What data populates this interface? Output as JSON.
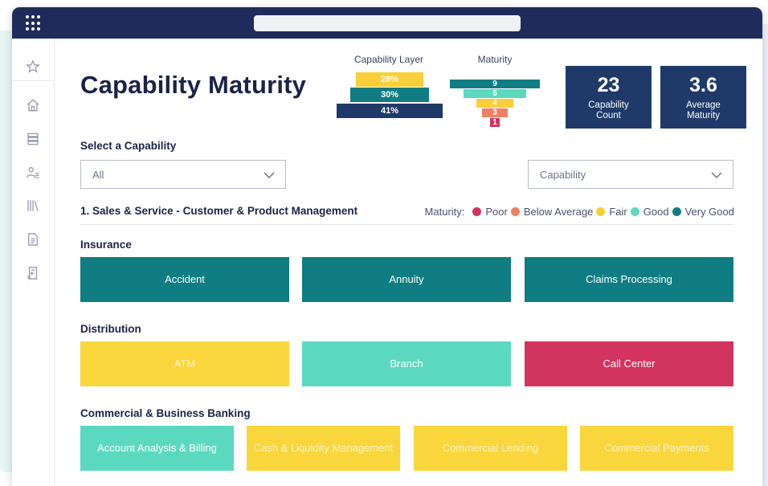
{
  "page": {
    "title": "Capability Maturity"
  },
  "capability_layer": {
    "title": "Capability Layer",
    "bars": [
      {
        "label": "28%",
        "color": "#f8cf3a"
      },
      {
        "label": "30%",
        "color": "#0f7d82"
      },
      {
        "label": "41%",
        "color": "#1f3a68"
      }
    ]
  },
  "maturity_funnel": {
    "title": "Maturity",
    "bars": [
      {
        "label": "9",
        "color": "#0f7d82"
      },
      {
        "label": "6",
        "color": "#5bd9c0"
      },
      {
        "label": "4",
        "color": "#f8cf3a"
      },
      {
        "label": "3",
        "color": "#f07f64"
      },
      {
        "label": "1",
        "color": "#d3335f"
      }
    ]
  },
  "stats": [
    {
      "value": "23",
      "label_line1": "Capability",
      "label_line2": "Count"
    },
    {
      "value": "3.6",
      "label_line1": "Average",
      "label_line2": "Maturity"
    }
  ],
  "filters": {
    "label": "Select a Capability",
    "left_value": "All",
    "right_value": "Capability"
  },
  "section": {
    "heading": "1. Sales & Service - Customer & Product Management"
  },
  "legend": {
    "title": "Maturity:",
    "items": [
      {
        "label": "Poor",
        "color": "#d3335f"
      },
      {
        "label": "Below Average",
        "color": "#f07f64"
      },
      {
        "label": "Fair",
        "color": "#f8cf3a"
      },
      {
        "label": "Good",
        "color": "#5bd9c0"
      },
      {
        "label": "Very Good",
        "color": "#0f7d82"
      }
    ]
  },
  "groups": [
    {
      "name": "Insurance",
      "tiles": [
        {
          "label": "Accident",
          "color": "#0f7d82"
        },
        {
          "label": "Annuity",
          "color": "#0f7d82"
        },
        {
          "label": "Claims Processing",
          "color": "#0f7d82"
        }
      ]
    },
    {
      "name": "Distribution",
      "tiles": [
        {
          "label": "ATM",
          "color": "#f8d63c"
        },
        {
          "label": "Branch",
          "color": "#5bd9c0"
        },
        {
          "label": "Call Center",
          "color": "#d3335f"
        }
      ]
    },
    {
      "name": "Commercial & Business Banking",
      "tiles": [
        {
          "label": "Account Analysis & Billing",
          "color": "#5bd9c0"
        },
        {
          "label": "Cash & Liquidity Management",
          "color": "#f8d63c"
        },
        {
          "label": "Commercial Lending",
          "color": "#f8d63c"
        },
        {
          "label": "Commercial Payments",
          "color": "#f8d63c"
        }
      ]
    }
  ],
  "icons": {
    "app_launcher": "grid-dots-icon",
    "sidebar": [
      "star-icon",
      "home-icon",
      "database-icon",
      "users-icon",
      "library-icon",
      "document-icon",
      "report-icon"
    ],
    "dropdown": "chevron-down-icon"
  }
}
